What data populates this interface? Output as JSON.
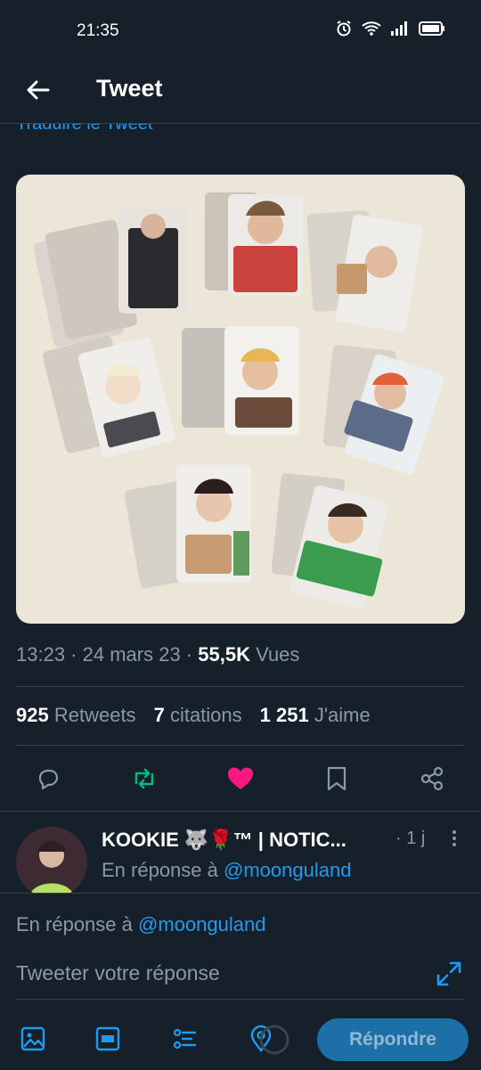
{
  "status_bar": {
    "time": "21:35",
    "icons": [
      "alarm-icon",
      "wifi-icon",
      "signal-icon",
      "battery-icon"
    ]
  },
  "header": {
    "title": "Tweet"
  },
  "tweet": {
    "translate_link": "Traduire le Tweet",
    "time": "13:23",
    "date": "24 mars 23",
    "views_count": "55,5K",
    "views_label": "Vues",
    "retweets_count": "925",
    "retweets_label": "Retweets",
    "quotes_count": "7",
    "quotes_label": "citations",
    "likes_count": "1 251",
    "likes_label": "J'aime",
    "retweeted": true,
    "liked": true
  },
  "colors": {
    "accent": "#1d9bf0",
    "retweet": "#00ba7c",
    "like": "#f91880",
    "background": "#15202b"
  },
  "reply": {
    "name": "KOOKIE 🐺🌹™ | NOTIC...",
    "time": "1 j",
    "reply_to_prefix": "En réponse à",
    "reply_to_handle": "@moonguland"
  },
  "composer": {
    "reply_to_prefix": "En réponse à",
    "reply_to_handle": "@moonguland",
    "placeholder": "Tweeter votre réponse",
    "submit_label": "Répondre"
  }
}
